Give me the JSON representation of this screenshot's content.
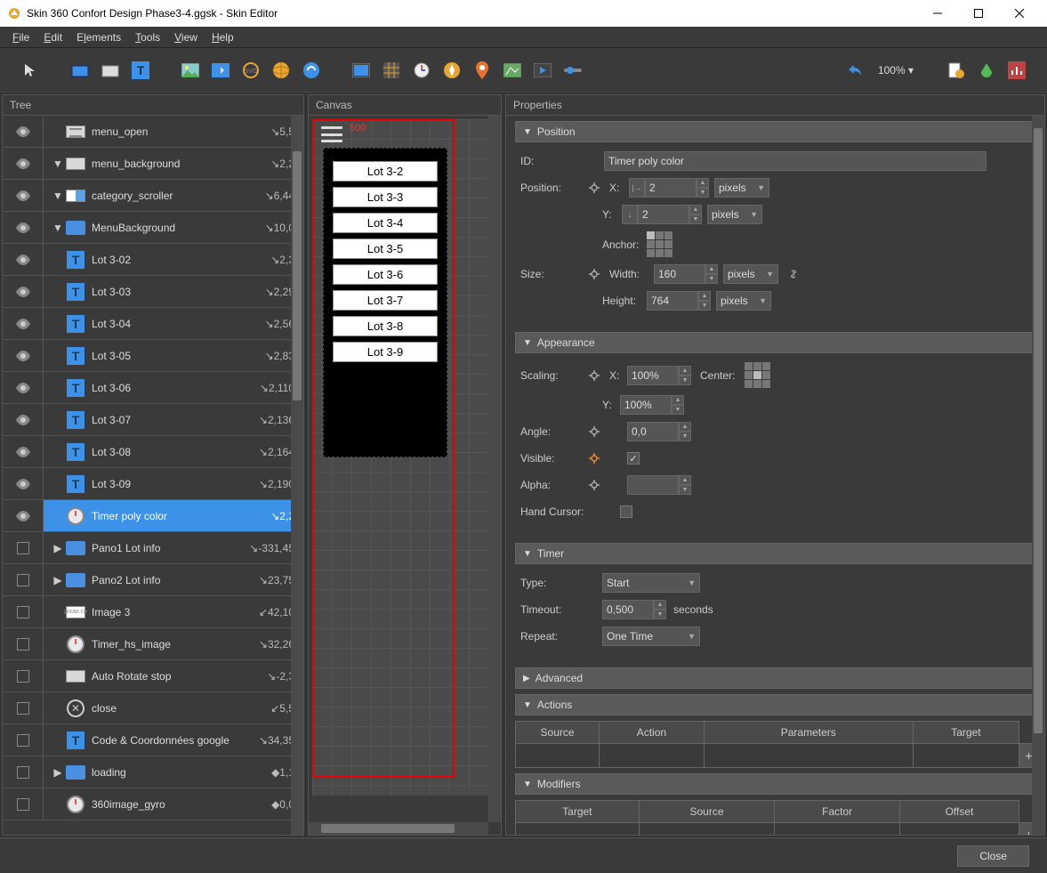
{
  "window": {
    "title": "Skin 360 Confort Design Phase3-4.ggsk - Skin Editor"
  },
  "menubar": [
    "File",
    "Edit",
    "Elements",
    "Tools",
    "View",
    "Help"
  ],
  "toolbar": {
    "zoom": "100%"
  },
  "panels": {
    "tree": "Tree",
    "canvas": "Canvas",
    "properties": "Properties"
  },
  "tree": [
    {
      "label": "menu_open",
      "coord": "↘5,5",
      "indent": 0,
      "icon": "lines",
      "vis": "eye",
      "expander": ""
    },
    {
      "label": "menu_background",
      "coord": "↘2,2",
      "indent": 0,
      "icon": "rect",
      "vis": "eye",
      "expander": "▼"
    },
    {
      "label": "category_scroller",
      "coord": "↘6,44",
      "indent": 1,
      "icon": "scroller",
      "vis": "eye",
      "expander": "▼"
    },
    {
      "label": "MenuBackground",
      "coord": "↘10,0",
      "indent": 2,
      "icon": "folder",
      "vis": "eye",
      "expander": "▼"
    },
    {
      "label": "Lot 3-02",
      "coord": "↘2,3",
      "indent": 4,
      "icon": "T",
      "vis": "eye",
      "expander": ""
    },
    {
      "label": "Lot 3-03",
      "coord": "↘2,29",
      "indent": 4,
      "icon": "T",
      "vis": "eye",
      "expander": ""
    },
    {
      "label": "Lot 3-04",
      "coord": "↘2,56",
      "indent": 4,
      "icon": "T",
      "vis": "eye",
      "expander": ""
    },
    {
      "label": "Lot 3-05",
      "coord": "↘2,83",
      "indent": 4,
      "icon": "T",
      "vis": "eye",
      "expander": ""
    },
    {
      "label": "Lot 3-06",
      "coord": "↘2,110",
      "indent": 4,
      "icon": "T",
      "vis": "eye",
      "expander": ""
    },
    {
      "label": "Lot 3-07",
      "coord": "↘2,136",
      "indent": 4,
      "icon": "T",
      "vis": "eye",
      "expander": ""
    },
    {
      "label": "Lot 3-08",
      "coord": "↘2,164",
      "indent": 4,
      "icon": "T",
      "vis": "eye",
      "expander": ""
    },
    {
      "label": "Lot 3-09",
      "coord": "↘2,190",
      "indent": 4,
      "icon": "T",
      "vis": "eye",
      "expander": ""
    },
    {
      "label": "Timer poly color",
      "coord": "↘2,2",
      "indent": 0,
      "icon": "timer",
      "vis": "eye",
      "expander": "",
      "selected": true
    },
    {
      "label": "Pano1 Lot info",
      "coord": "↘-331,45",
      "indent": 0,
      "icon": "folder",
      "vis": "box",
      "expander": "▶"
    },
    {
      "label": "Pano2 Lot info",
      "coord": "↘23,75",
      "indent": 0,
      "icon": "folder",
      "vis": "box",
      "expander": "▶"
    },
    {
      "label": "Image 3",
      "coord": "↙42,10",
      "indent": 0,
      "icon": "image",
      "vis": "box",
      "expander": ""
    },
    {
      "label": "Timer_hs_image",
      "coord": "↘32,26",
      "indent": 0,
      "icon": "timer",
      "vis": "box",
      "expander": ""
    },
    {
      "label": "Auto Rotate stop",
      "coord": "↘-2,3",
      "indent": 0,
      "icon": "rect",
      "vis": "box",
      "expander": ""
    },
    {
      "label": "close",
      "coord": "↙5,5",
      "indent": 0,
      "icon": "close",
      "vis": "box",
      "expander": ""
    },
    {
      "label": "Code & Coordonnées google",
      "coord": "↘34,35",
      "indent": 0,
      "icon": "T",
      "vis": "box",
      "expander": ""
    },
    {
      "label": "loading",
      "coord": "◆1,1",
      "indent": 0,
      "icon": "folder",
      "vis": "box",
      "expander": "▶"
    },
    {
      "label": "360image_gyro",
      "coord": "◆0,0",
      "indent": 0,
      "icon": "timer",
      "vis": "box",
      "expander": ""
    }
  ],
  "canvas": {
    "sizeLabel": "500",
    "lots": [
      "Lot 3-2",
      "Lot 3-3",
      "Lot 3-4",
      "Lot 3-5",
      "Lot 3-6",
      "Lot 3-7",
      "Lot 3-8",
      "Lot 3-9"
    ]
  },
  "properties": {
    "sections": {
      "position": "Position",
      "appearance": "Appearance",
      "timer": "Timer",
      "advanced": "Advanced",
      "actions": "Actions",
      "modifiers": "Modifiers"
    },
    "position": {
      "idLabel": "ID:",
      "id": "Timer poly color",
      "positionLabel": "Position:",
      "xLabel": "X:",
      "x": "2",
      "xUnit": "pixels",
      "yLabel": "Y:",
      "y": "2",
      "yUnit": "pixels",
      "anchorLabel": "Anchor:",
      "sizeLabel": "Size:",
      "widthLabel": "Width:",
      "width": "160",
      "widthUnit": "pixels",
      "heightLabel": "Height:",
      "height": "764",
      "heightUnit": "pixels"
    },
    "appearance": {
      "scalingLabel": "Scaling:",
      "scaleXLabel": "X:",
      "scaleX": "100%",
      "centerLabel": "Center:",
      "scaleYLabel": "Y:",
      "scaleY": "100%",
      "angleLabel": "Angle:",
      "angle": "0,0",
      "visibleLabel": "Visible:",
      "visible": true,
      "alphaLabel": "Alpha:",
      "alpha": "",
      "handCursorLabel": "Hand Cursor:",
      "handCursor": false
    },
    "timer": {
      "typeLabel": "Type:",
      "type": "Start",
      "timeoutLabel": "Timeout:",
      "timeout": "0,500",
      "timeoutUnit": "seconds",
      "repeatLabel": "Repeat:",
      "repeat": "One Time"
    },
    "actions": {
      "headers": [
        "Source",
        "Action",
        "Parameters",
        "Target"
      ]
    },
    "modifiers": {
      "headers": [
        "Target",
        "Source",
        "Factor",
        "Offset"
      ]
    }
  },
  "bottom": {
    "close": "Close"
  }
}
